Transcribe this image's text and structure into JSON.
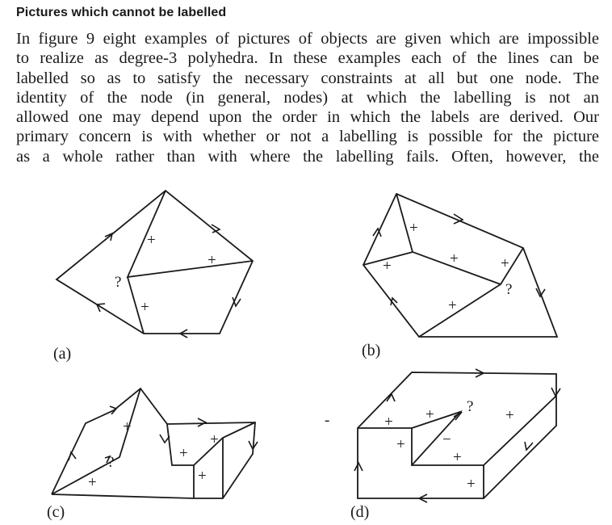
{
  "section_heading": "Pictures which cannot be labelled",
  "paragraph_lines": [
    "In figure 9 eight examples of pictures of objects are given which are impossible",
    "to realize as degree-3 polyhedra. In these examples each of the lines can be",
    "labelled so as to satisfy the necessary constraints at all but one node. The",
    "identity of the node (in general, nodes) at which the labelling is not an",
    "allowed one may depend upon the order in which the labels are derived. Our",
    "primary concern is with whether or not a labelling is possible for the picture",
    "as a whole rather than with where the labelling fails. Often, however, the"
  ],
  "figures": {
    "a": {
      "caption": "(a)",
      "question": "?",
      "plus": "+"
    },
    "b": {
      "caption": "(b)",
      "question": "?",
      "plus": "+"
    },
    "c": {
      "caption": "(c)",
      "question": "?",
      "plus": "+"
    },
    "d": {
      "caption": "(d)",
      "question": "?",
      "plus": "+",
      "minus": "−"
    },
    "stray_mark": "-"
  }
}
